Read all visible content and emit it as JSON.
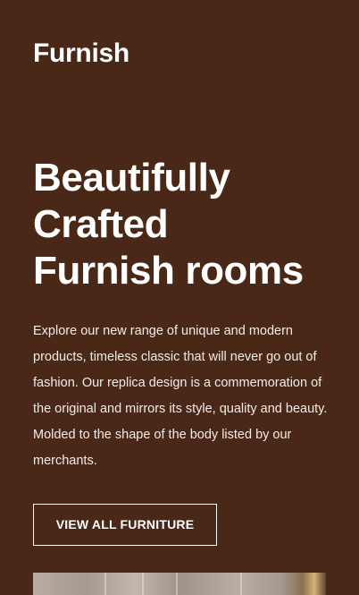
{
  "header": {
    "logo_text": "Furnish"
  },
  "hero": {
    "title_lines": [
      "Beautifully",
      "Crafted",
      "Furnish rooms"
    ],
    "description": "Explore our new range of unique and modern products, timeless classic that will never go out of fashion. Our replica design is a commemoration of the original and mirrors its style, quality and beauty. Molded to the shape of the body listed by our merchants.",
    "cta_label": "VIEW ALL FURNITURE"
  },
  "colors": {
    "background": "#4a2818",
    "text": "#ffffff"
  }
}
